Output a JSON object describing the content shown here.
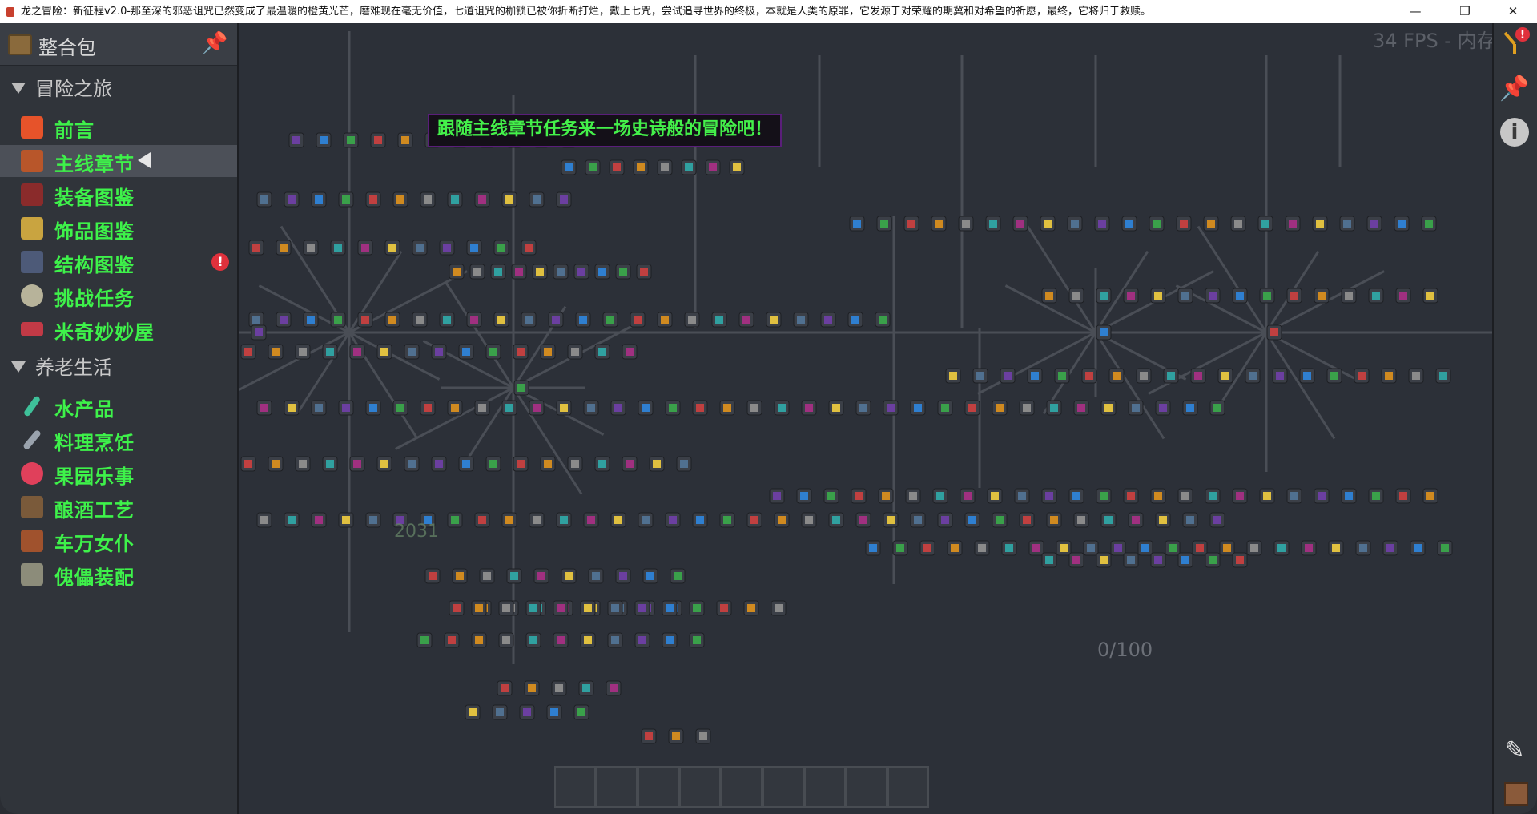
{
  "window": {
    "title": "龙之冒险：新征程v2.0-那至深的邪恶诅咒已然变成了最温暖的橙黄光芒，磨难现在毫无价值，七道诅咒的枷锁已被你折断打烂，戴上七咒，尝试追寻世界的终极，本就是人类的原罪，它发源于对荣耀的期冀和对希望的祈愿，最终，它将归于救赎。",
    "minimize": "—",
    "maximize": "❐",
    "close": "✕"
  },
  "sidebar": {
    "header_title": "整合包",
    "pin_icon": "📌",
    "sections": [
      {
        "title": "冒险之旅",
        "items": [
          {
            "label": "前言",
            "icon": "orange-star-icon",
            "color": "#e6532a"
          },
          {
            "label": "主线章节",
            "icon": "treasure-chest-icon",
            "color": "#b8562a",
            "active": true
          },
          {
            "label": "装备图鉴",
            "icon": "crimson-sword-icon",
            "color": "#8a2b2b"
          },
          {
            "label": "饰品图鉴",
            "icon": "golden-sword-icon",
            "color": "#c9a440"
          },
          {
            "label": "结构图鉴",
            "icon": "tower-icon",
            "color": "#4d5a78",
            "badge": "!"
          },
          {
            "label": "挑战任务",
            "icon": "round-shield-icon",
            "color": "#b7b39a"
          },
          {
            "label": "米奇妙妙屋",
            "icon": "red-banner-icon",
            "color": "#c23a46"
          }
        ]
      },
      {
        "title": "养老生活",
        "items": [
          {
            "label": "水产品",
            "icon": "fishing-rod-icon",
            "color": "#3ec19a"
          },
          {
            "label": "料理烹饪",
            "icon": "knife-icon",
            "color": "#9aa3ad"
          },
          {
            "label": "果园乐事",
            "icon": "berries-icon",
            "color": "#e0405b"
          },
          {
            "label": "酿酒工艺",
            "icon": "barrel-icon",
            "color": "#7a5a3a"
          },
          {
            "label": "车万女仆",
            "icon": "maid-icon",
            "color": "#a0522d"
          },
          {
            "label": "傀儡装配",
            "icon": "golem-icon",
            "color": "#8c8c7a"
          }
        ]
      }
    ]
  },
  "canvas": {
    "tooltip": "跟随主线章节任务来一场史诗般的冒险吧！",
    "fps_text": "34 FPS - 内存",
    "coord_text": "2031",
    "progress_text": "0/100"
  },
  "rightbar": {
    "top_icon": "quest-tree-alert-icon",
    "pin": "📌",
    "info": "i",
    "edit": "✎"
  }
}
